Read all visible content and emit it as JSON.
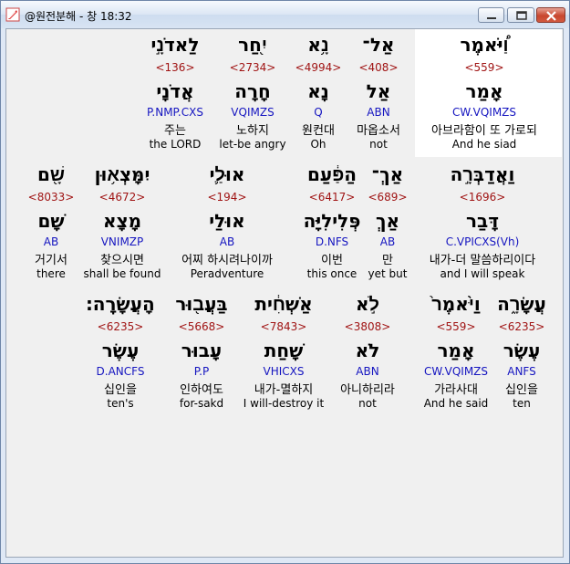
{
  "window": {
    "title": "@원전분해 - 창 18:32",
    "app_icon": "feather-quill-icon",
    "buttons": {
      "minimize": "minimize-icon",
      "maximize": "maximize-icon",
      "close": "close-icon"
    }
  },
  "verses": [
    {
      "highlight_word": 4,
      "words": [
        {
          "hebrew": "לַאדֹנָ֣י",
          "strong": "<136>",
          "lemma": "אֲדֹנָי",
          "morph": "P.NMP.CXS",
          "korean": "주는",
          "english": "the LORD"
        },
        {
          "hebrew": "יִ֖חַר",
          "strong": "<2734>",
          "lemma": "חָרָה",
          "morph": "VQIMZS",
          "korean": "노하지",
          "english": "let-be angry"
        },
        {
          "hebrew": "נָ֥א",
          "strong": "<4994>",
          "lemma": "נָא",
          "morph": "Q",
          "korean": "원컨대",
          "english": "Oh"
        },
        {
          "hebrew": "אַל־",
          "strong": "<408>",
          "lemma": "אַל",
          "morph": "ABN",
          "korean": "마옵소서",
          "english": "not"
        },
        {
          "hebrew": "וַ֠יֹּאמֶר",
          "strong": "<559>",
          "lemma": "אָמַר",
          "morph": "CW.VQIMZS",
          "korean": "아브라함이 또 가로되",
          "english": "And he siad"
        }
      ]
    },
    {
      "highlight_word": -1,
      "words": [
        {
          "hebrew": "שָׁ֖ם",
          "strong": "<8033>",
          "lemma": "שָׁם",
          "morph": "AB",
          "korean": "거기서",
          "english": "there"
        },
        {
          "hebrew": "יִמָּצְא֥וּן",
          "strong": "<4672>",
          "lemma": "מָצָא",
          "morph": "VNIMZP",
          "korean": "찾으시면",
          "english": "shall be found"
        },
        {
          "hebrew": "אוּלַ֛י",
          "strong": "<194>",
          "lemma": "אוּלַי",
          "morph": "AB",
          "korean": "어찌 하시려나이까",
          "english": "Peradventure"
        },
        {
          "hebrew": "הַפַּ֔עַם",
          "strong": "<6417>",
          "lemma": "פְּלִילִיָּה",
          "morph": "D.NFS",
          "korean": "이번",
          "english": "this once"
        },
        {
          "hebrew": "אַךְ־",
          "strong": "<689>",
          "lemma": "אַךְ",
          "morph": "AB",
          "korean": "만",
          "english": "yet but"
        },
        {
          "hebrew": "וַאֲדַבְּרָ֣ה",
          "strong": "<1696>",
          "lemma": "דָּבַר",
          "morph": "C.VPICXS(Vh)",
          "korean": "내가-더 말씀하리이다",
          "english": "and I will speak"
        }
      ]
    },
    {
      "highlight_word": -1,
      "words": [
        {
          "hebrew": "הָעֲשָׂרָֽה׃",
          "strong": "<6235>",
          "lemma": "עֶשֶׂר",
          "morph": "D.ANCFS",
          "korean": "십인을",
          "english": "ten's"
        },
        {
          "hebrew": "בַּעֲב֖וּר",
          "strong": "<5668>",
          "lemma": "עָבוּר",
          "morph": "P.P",
          "korean": "인하여도",
          "english": "for-sakd"
        },
        {
          "hebrew": "אַשְׁחִ֔ית",
          "strong": "<7843>",
          "lemma": "שָׁחַת",
          "morph": "VHICXS",
          "korean": "내가-멸하지",
          "english": "I will-destroy it"
        },
        {
          "hebrew": "לֹ֣א",
          "strong": "<3808>",
          "lemma": "לֹא",
          "morph": "ABN",
          "korean": "아니하리라",
          "english": "not"
        },
        {
          "hebrew": "וַיֹּ֙אמֶר֙",
          "strong": "<559>",
          "lemma": "אָמַר",
          "morph": "CW.VQIMZS",
          "korean": "가라사대",
          "english": "And he said"
        },
        {
          "hebrew": "עֲשָׂרָ֑ה",
          "strong": "<6235>",
          "lemma": "עֶשֶׂר",
          "morph": "ANFS",
          "korean": "십인을",
          "english": "ten"
        }
      ]
    }
  ]
}
